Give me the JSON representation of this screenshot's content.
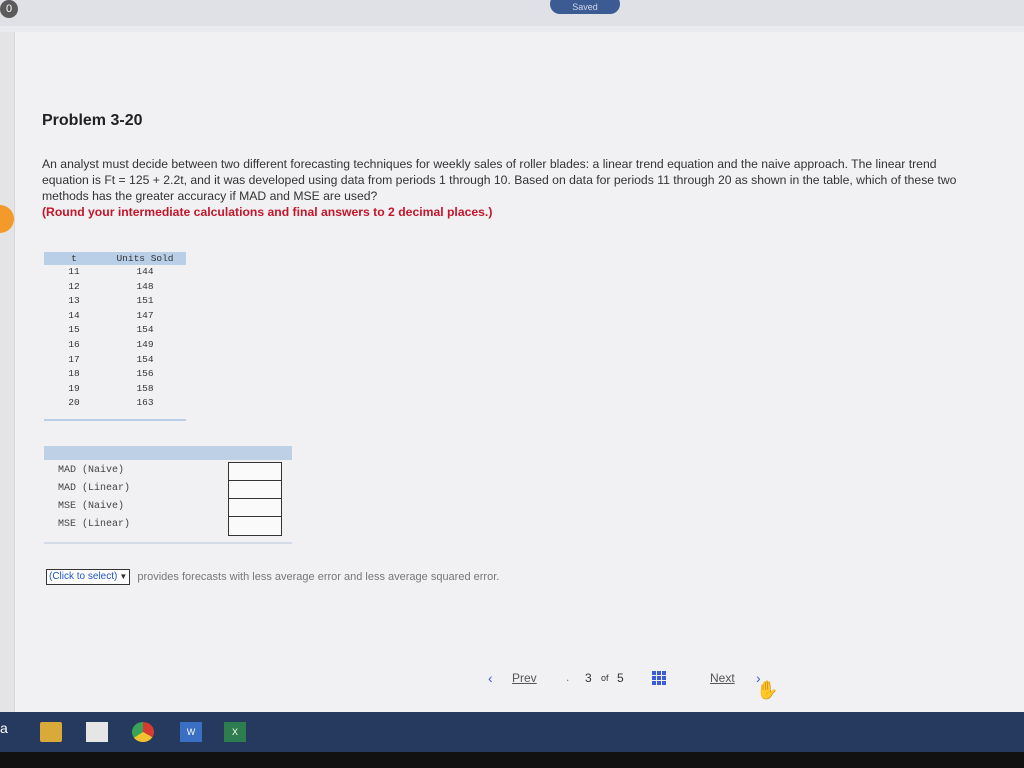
{
  "top_badge": "0",
  "saved_label": "Saved",
  "problem": {
    "title": "Problem 3-20",
    "text": "An analyst must decide between two different forecasting techniques for weekly sales of roller blades: a linear trend equation and the naive approach. The linear trend equation is Ft = 125 + 2.2t, and it was developed using data from periods 1 through 10. Based on data for periods 11 through 20 as shown in the table, which of these two methods has the greater accuracy if MAD and MSE are used?",
    "instruction": "(Round your intermediate calculations and final answers to 2 decimal places.)"
  },
  "table": {
    "headers": [
      "t",
      "Units Sold"
    ],
    "rows": [
      [
        "11",
        "144"
      ],
      [
        "12",
        "148"
      ],
      [
        "13",
        "151"
      ],
      [
        "14",
        "147"
      ],
      [
        "15",
        "154"
      ],
      [
        "16",
        "149"
      ],
      [
        "17",
        "154"
      ],
      [
        "18",
        "156"
      ],
      [
        "19",
        "158"
      ],
      [
        "20",
        "163"
      ]
    ]
  },
  "answers": {
    "rows": [
      {
        "label": "MAD (Naive)",
        "value": ""
      },
      {
        "label": "MAD (Linear)",
        "value": ""
      },
      {
        "label": "MSE (Naive)",
        "value": ""
      },
      {
        "label": "MSE (Linear)",
        "value": ""
      }
    ]
  },
  "select": {
    "value": "(Click to select)",
    "arrow": "▼",
    "suffix": "provides forecasts with less average error and less average squared error."
  },
  "pager": {
    "prev": "Prev",
    "current": "3",
    "of": "of",
    "total": "5",
    "next": "Next"
  },
  "taskbar": {
    "a_label": "a",
    "word_label": "W",
    "excel_label": "X"
  }
}
